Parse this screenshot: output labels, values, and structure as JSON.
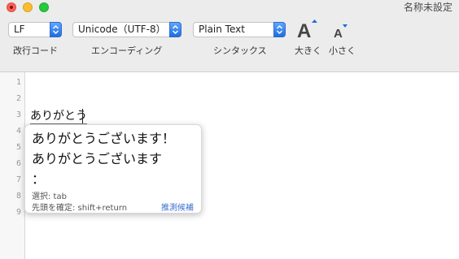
{
  "window": {
    "title": "名称未設定"
  },
  "toolbar": {
    "line_ending": {
      "value": "LF",
      "label": "改行コード"
    },
    "encoding": {
      "value": "Unicode（UTF-8）",
      "label": "エンコーディング"
    },
    "syntax": {
      "value": "Plain Text",
      "label": "シンタックス"
    },
    "bigger_label": "大きく",
    "smaller_label": "小さく"
  },
  "editor": {
    "line_numbers": [
      "1",
      "2",
      "3",
      "4",
      "5",
      "6",
      "7",
      "8",
      "9"
    ],
    "current_text": "ありがとう"
  },
  "candidates": {
    "items": [
      "ありがとうございます！",
      "ありがとうございます",
      "："
    ],
    "select_hint": "選択: tab",
    "confirm_hint": "先頭を確定: shift+return",
    "predictive_link": "推測候補"
  },
  "colors": {
    "accent": "#1f6de0",
    "close": "#ff5f56",
    "minimize": "#ffbd2e",
    "maximize": "#27c93f"
  }
}
